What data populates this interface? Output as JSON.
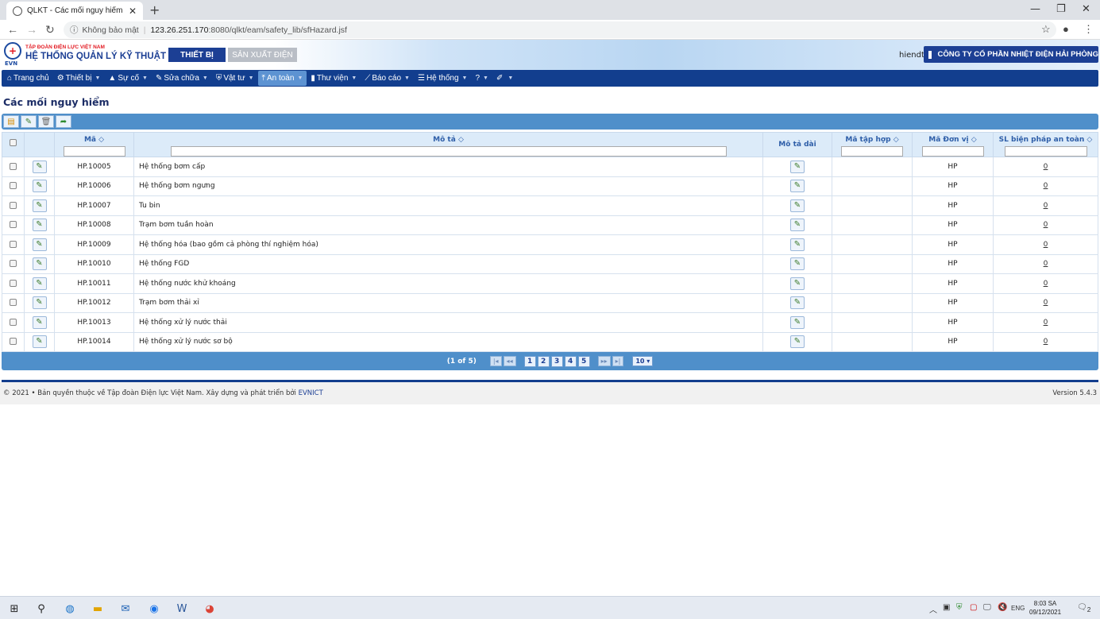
{
  "browser": {
    "tab_title": "QLKT - Các mối nguy hiểm",
    "security_label": "Không bảo mật",
    "url_host": "123.26.251.170",
    "url_rest": ":8080/qlkt/eam/safety_lib/sfHazard.jsf"
  },
  "header": {
    "corp_name": "TẬP ĐOÀN ĐIỆN LỰC VIỆT NAM",
    "system_name": "HỆ THỐNG QUẢN LÝ KỸ THUẬT",
    "evn_label": "EVN",
    "btn_equipment": "THIẾT BỊ",
    "btn_production": "SẢN XUẤT ĐIỆN",
    "username": "hiendt",
    "company": "CÔNG TY CỔ PHẦN NHIỆT ĐIỆN HẢI PHÒNG"
  },
  "menu": [
    {
      "label": "Trang chủ",
      "icon": "home-icon",
      "dropdown": false
    },
    {
      "label": "Thiết bị",
      "icon": "gears-icon",
      "dropdown": true
    },
    {
      "label": "Sự cố",
      "icon": "warning-icon",
      "dropdown": true
    },
    {
      "label": "Sửa chữa",
      "icon": "wrench-icon",
      "dropdown": true
    },
    {
      "label": "Vật tư",
      "icon": "shield-icon",
      "dropdown": true
    },
    {
      "label": "An toàn",
      "icon": "tool-icon",
      "dropdown": true,
      "active": true
    },
    {
      "label": "Thư viện",
      "icon": "book-icon",
      "dropdown": true
    },
    {
      "label": "Báo cáo",
      "icon": "chart-icon",
      "dropdown": true
    },
    {
      "label": "Hệ thống",
      "icon": "list-icon",
      "dropdown": true
    },
    {
      "label": "?",
      "icon": "",
      "dropdown": true
    },
    {
      "label": "",
      "icon": "brush-icon",
      "dropdown": true
    }
  ],
  "page_title": "Các mối nguy hiểm",
  "columns": {
    "code": "Mã",
    "desc": "Mô tả",
    "long_desc": "Mô tả dài",
    "set_code": "Mã tập hợp",
    "unit_code": "Mã Đơn vị",
    "safety_count": "SL biện pháp an toàn"
  },
  "rows": [
    {
      "code": "HP.10005",
      "desc": "Hệ thống bơm cấp",
      "unit": "HP",
      "count": "0"
    },
    {
      "code": "HP.10006",
      "desc": "Hệ thống bơm ngưng",
      "unit": "HP",
      "count": "0"
    },
    {
      "code": "HP.10007",
      "desc": "Tu bin",
      "unit": "HP",
      "count": "0"
    },
    {
      "code": "HP.10008",
      "desc": "Trạm bơm tuần hoàn",
      "unit": "HP",
      "count": "0"
    },
    {
      "code": "HP.10009",
      "desc": "Hệ thống hóa (bao gồm cả phòng thí nghiệm hóa)",
      "unit": "HP",
      "count": "0"
    },
    {
      "code": "HP.10010",
      "desc": "Hệ thống FGD",
      "unit": "HP",
      "count": "0"
    },
    {
      "code": "HP.10011",
      "desc": "Hệ thống nước khử khoáng",
      "unit": "HP",
      "count": "0"
    },
    {
      "code": "HP.10012",
      "desc": "Trạm bơm thải xỉ",
      "unit": "HP",
      "count": "0"
    },
    {
      "code": "HP.10013",
      "desc": "Hệ thống xử lý nước thải",
      "unit": "HP",
      "count": "0"
    },
    {
      "code": "HP.10014",
      "desc": "Hệ thống xử lý nước sơ bộ",
      "unit": "HP",
      "count": "0"
    }
  ],
  "pager": {
    "info": "(1 of 5)",
    "pages": [
      "1",
      "2",
      "3",
      "4",
      "5"
    ],
    "page_size": "10"
  },
  "footer": {
    "copyright": "© 2021 • Bản quyền thuộc về Tập đoàn Điện lực Việt Nam. Xây dựng và phát triển bởi",
    "developer": "EVNICT",
    "version": "Version 5.4.3"
  },
  "taskbar": {
    "lang": "ENG",
    "time": "8:03 SA",
    "date": "09/12/2021",
    "notif_count": "2"
  }
}
